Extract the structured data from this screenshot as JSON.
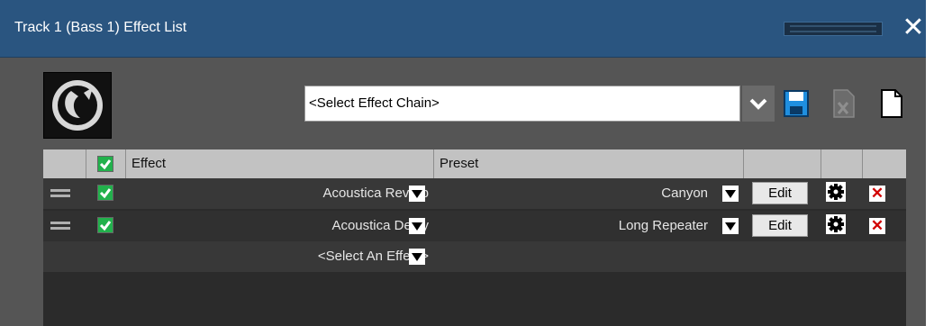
{
  "window": {
    "title": "Track 1 (Bass 1) Effect List",
    "close_icon": "close-icon"
  },
  "chain": {
    "value": "<Select Effect Chain>",
    "dropdown_icon": "chevron-down-icon",
    "save_icon": "save-icon",
    "delete_icon": "delete-file-icon",
    "new_icon": "new-file-icon"
  },
  "table": {
    "columns": [
      "Effect",
      "Preset"
    ],
    "rows": [
      {
        "effect": "Acoustica Reverb",
        "preset": "Canyon",
        "edit_label": "Edit",
        "enabled": true
      },
      {
        "effect": "Acoustica Delay",
        "preset": "Long Repeater",
        "edit_label": "Edit",
        "enabled": true
      }
    ],
    "select_effect": "<Select An Effect>"
  },
  "colors": {
    "titlebar": "#2a5580",
    "background": "#555555",
    "check": "#22b14c",
    "delete": "#d10000"
  }
}
